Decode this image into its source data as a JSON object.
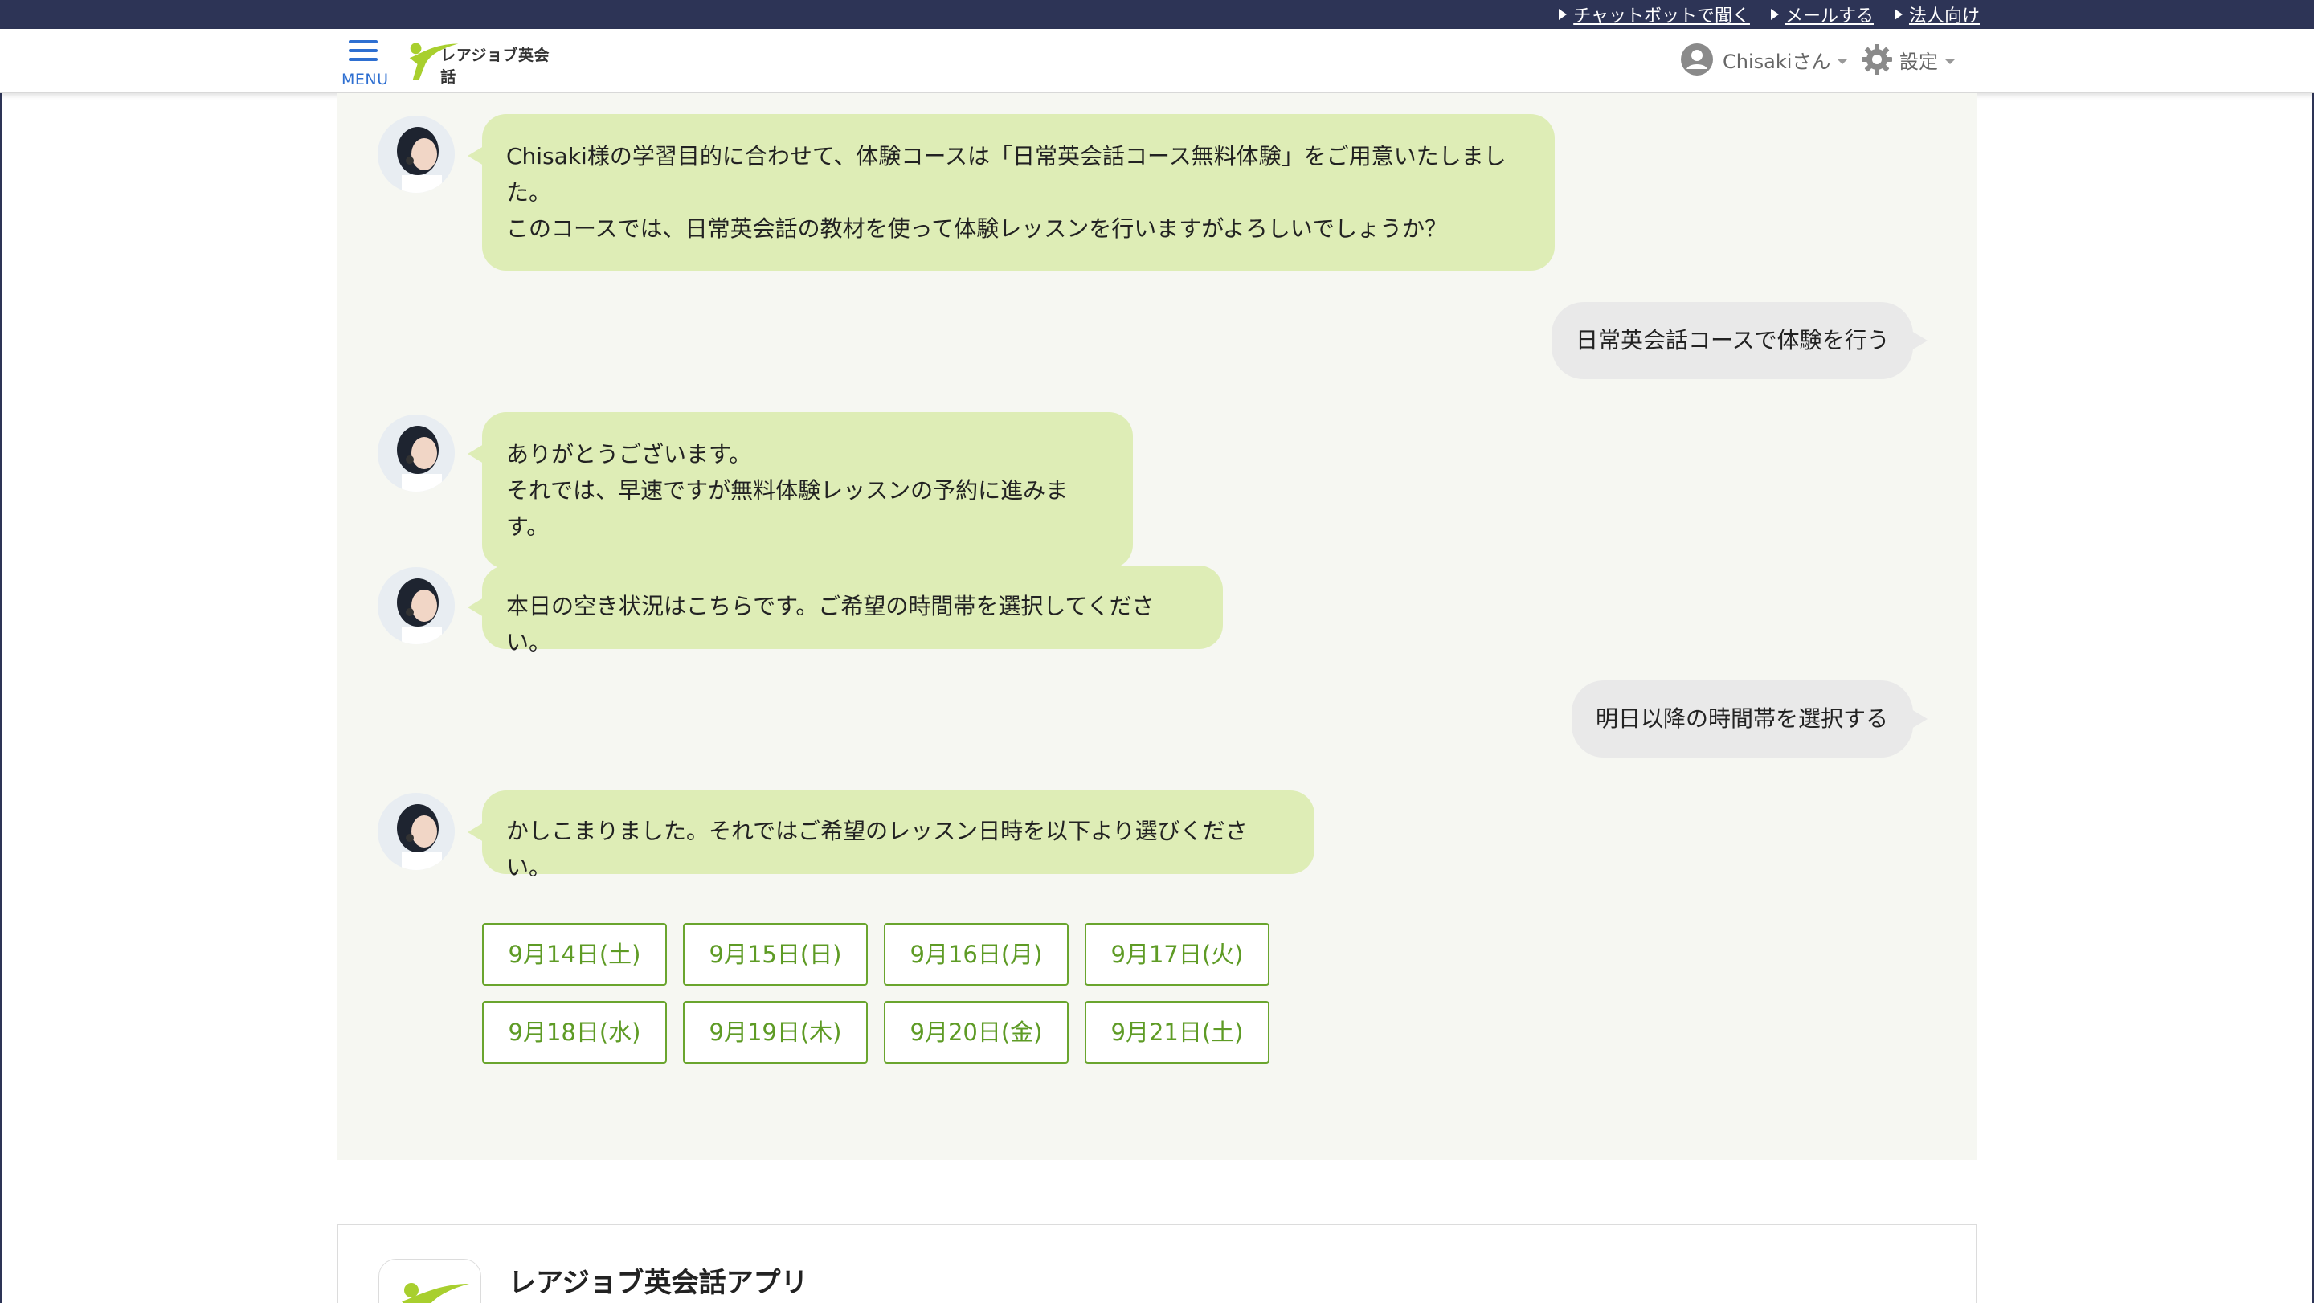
{
  "topbar": {
    "links": [
      "チャットボットで聞く",
      "メールする",
      "法人向け"
    ],
    "background": "#2d3456"
  },
  "header": {
    "menu_label": "MENU",
    "logo_text": "レアジョブ英会話",
    "user_label": "Chisakiさん",
    "settings_label": "設定"
  },
  "chat": {
    "messages": [
      {
        "from": "bot",
        "lines": [
          "Chisaki様の学習目的に合わせて、体験コースは「日常英会話コース無料体験」をご用意いたしまし",
          "た。",
          "このコースでは、日常英会話の教材を使って体験レッスンを行いますがよろしいでしょうか？"
        ]
      },
      {
        "from": "user",
        "text": "日常英会話コースで体験を行う"
      },
      {
        "from": "bot",
        "lines": [
          "ありがとうございます。",
          "それでは、早速ですが無料体験レッスンの予約に進みます。"
        ]
      },
      {
        "from": "bot",
        "lines": [
          "本日の空き状況はこちらです。ご希望の時間帯を選択してください。"
        ]
      },
      {
        "from": "user",
        "text": "明日以降の時間帯を選択する"
      },
      {
        "from": "bot",
        "lines": [
          "かしこまりました。それではご希望のレッスン日時を以下より選びください。"
        ]
      }
    ],
    "dates": [
      "9月14日(土)",
      "9月15日(日)",
      "9月16日(月)",
      "9月17日(火)",
      "9月18日(水)",
      "9月19日(木)",
      "9月20日(金)",
      "9月21日(土)"
    ],
    "bot_bubble_color": "#deedb6",
    "user_bubble_color": "#e9e9e9",
    "date_accent": "#6aa52e"
  },
  "footer": {
    "app_title": "レアジョブ英会話アプリ"
  }
}
